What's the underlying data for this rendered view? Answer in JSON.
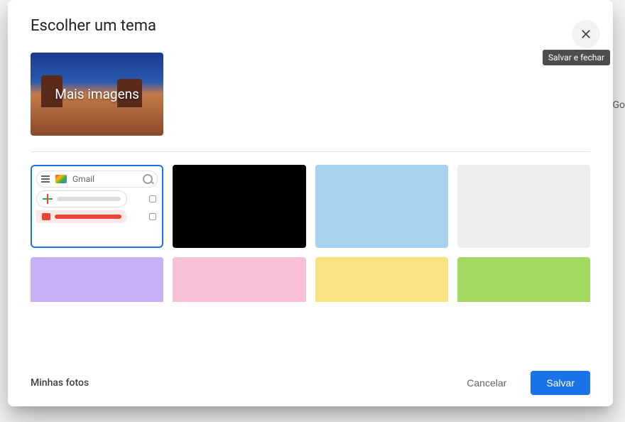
{
  "modal": {
    "title": "Escolher um tema",
    "close_tooltip": "Salvar e fechar",
    "more_images_label": "Mais imagens"
  },
  "themes": {
    "default_preview": {
      "gmail_label": "Gmail"
    }
  },
  "colors": {
    "black": "#000000",
    "lightblue": "#a7d3f0",
    "lightgray": "#eeeeee",
    "lavender": "#c8aef2",
    "pink": "#f7bfd8",
    "yellow": "#fbe280",
    "green": "#a3d960"
  },
  "footer": {
    "my_photos": "Minhas fotos",
    "cancel": "Cancelar",
    "save": "Salvar"
  },
  "backdrop": {
    "hint": "Go"
  }
}
